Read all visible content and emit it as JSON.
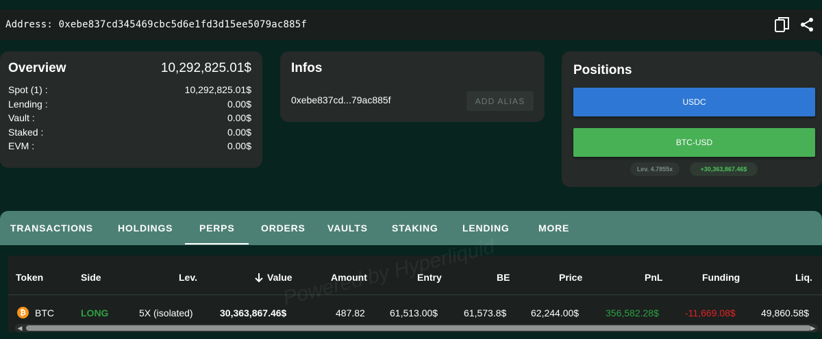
{
  "address_bar": {
    "label": "Address: 0xebe837cd345469cbc5d6e1fd3d15ee5079ac885f",
    "icons": [
      "copy-icon",
      "share-icon"
    ]
  },
  "overview": {
    "title": "Overview",
    "total": "10,292,825.01$",
    "rows": [
      {
        "label": "Spot (1) :",
        "value": "10,292,825.01$"
      },
      {
        "label": "Lending :",
        "value": "0.00$"
      },
      {
        "label": "Vault :",
        "value": "0.00$"
      },
      {
        "label": "Staked :",
        "value": "0.00$"
      },
      {
        "label": "EVM :",
        "value": "0.00$"
      }
    ]
  },
  "infos": {
    "title": "Infos",
    "address_short": "0xebe837cd...79ac885f",
    "add_alias": "ADD ALIAS"
  },
  "positions": {
    "title": "Positions",
    "buttons": [
      "USDC",
      "BTC-USD"
    ],
    "leverage_chip": "Lev. 4.7855x",
    "pnl_chip": "+30,363,867.46$"
  },
  "tabs": [
    "TRANSACTIONS",
    "HOLDINGS",
    "PERPS",
    "ORDERS",
    "VAULTS",
    "STAKING",
    "LENDING",
    "MORE"
  ],
  "active_tab": "PERPS",
  "table": {
    "headers": [
      "Token",
      "Side",
      "Lev.",
      "Value",
      "Amount",
      "Entry",
      "BE",
      "Price",
      "PnL",
      "Funding",
      "Liq."
    ],
    "rows": [
      {
        "token": "BTC",
        "side": "LONG",
        "lev": "5X (isolated)",
        "value": "30,363,867.46$",
        "amount": "487.82",
        "entry": "61,513.00$",
        "be": "61,573.8$",
        "price": "62,244.00$",
        "pnl": "356,582.28$",
        "funding": "-11,669.08$",
        "liq": "49,860.58$"
      }
    ]
  },
  "watermark": "Powered by Hyperliquid",
  "colors": {
    "background": "#07241e",
    "card": "#262a29",
    "tabbar": "#4d8074",
    "usdc": "#2f77d4",
    "btc": "#48b055",
    "positive": "#2ea043",
    "negative": "#e02424",
    "bitcoin": "#f7931a"
  }
}
